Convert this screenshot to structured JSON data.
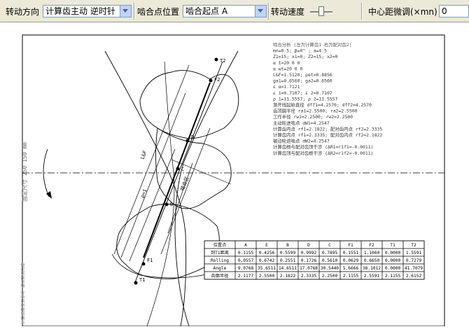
{
  "toolbar": {
    "direction_label": "转动方向",
    "direction_value": "计算齿主动 逆时针",
    "mesh_label": "啮合点位置",
    "mesh_value": "啮合起点 A",
    "speed_label": "转动速度",
    "speed_level": 0.5,
    "center_label": "中心距微调(×mn)",
    "center_value": "0"
  },
  "drawing": {
    "side_label": "固定尺寸 250 150 mm",
    "footer_label": "计算结果仅供参考 请以实测为准",
    "dim_label": "L&F",
    "pitch_label": "ρ=1",
    "zone_label": "啮合区",
    "points": {
      "t2": "T2",
      "f2": "F2",
      "d": "D",
      "c": "C",
      "b": "B",
      "f1": "F1",
      "t1": "T1"
    }
  },
  "analysis": {
    "lines": [
      "啮合分析 (左为计算齿1  右为配对齿2)",
      "mn=0.5; β=0° ; a=4.5",
      "Z1=15; x1=0; Z2=15; x2=0",
      "α t=20  0  0",
      "α wt=20  0  0",
      "L&F=1.5120; pet=0.8856",
      "ga1=0.6560; ga2=0.6560",
      "ε α=1.7121",
      "ε 1=0.7107; ε 2=0.7107",
      "ρ 1=11.5557; ρ 2=11.5557",
      "渐开线起始直径 dff1=4.2570; dff2=4.2570",
      "齿顶圆半径 ra1=2.5500; ra2=2.5500",
      "工作半径 rw1=2.2500; rw2=2.2500",
      "主动轮进啮点 dW1=4.2547",
      "计算齿内点 rf1=2.1822; 配对齿内点 rf2=2.3335",
      "计算齿内点 rf1=2.3335; 配对齿内点 rf2=2.1822",
      "被动轮退啮点 dW2=4.2547",
      "计算齿根与配对齿顶干涉 (ΔR1=r1f1=-0.0011)",
      "计算齿顶与配对齿根干涉 (ΔR2=r1f2=-0.0011)"
    ]
  },
  "table": {
    "headers": [
      "位置点",
      "A",
      "E",
      "B",
      "D",
      "C",
      "F1",
      "F2",
      "T1",
      "T2"
    ],
    "rows": [
      [
        "到T1距离",
        "0.1155",
        "0.4256",
        "0.5599",
        "0.9992",
        "0.7895",
        "0.1551",
        "1.1060",
        "0.0000",
        "1.5591"
      ],
      [
        "Rolling",
        "0.0557",
        "0.6742",
        "0.2551",
        "0.1726",
        "0.5610",
        "0.0629",
        "0.6650",
        "0.0000",
        "0.7279"
      ],
      [
        "Angle",
        "9.0768",
        "35.6511",
        "14.6511",
        "17.0768",
        "30.5440",
        "5.6666",
        "38.1012",
        "0.0000",
        "41.7079"
      ],
      [
        "齿廓半径",
        "2.1177",
        "2.5500",
        "2.1822",
        "2.3335",
        "2.2500",
        "2.1155",
        "2.5591",
        "2.1155",
        "2.6152"
      ]
    ]
  }
}
